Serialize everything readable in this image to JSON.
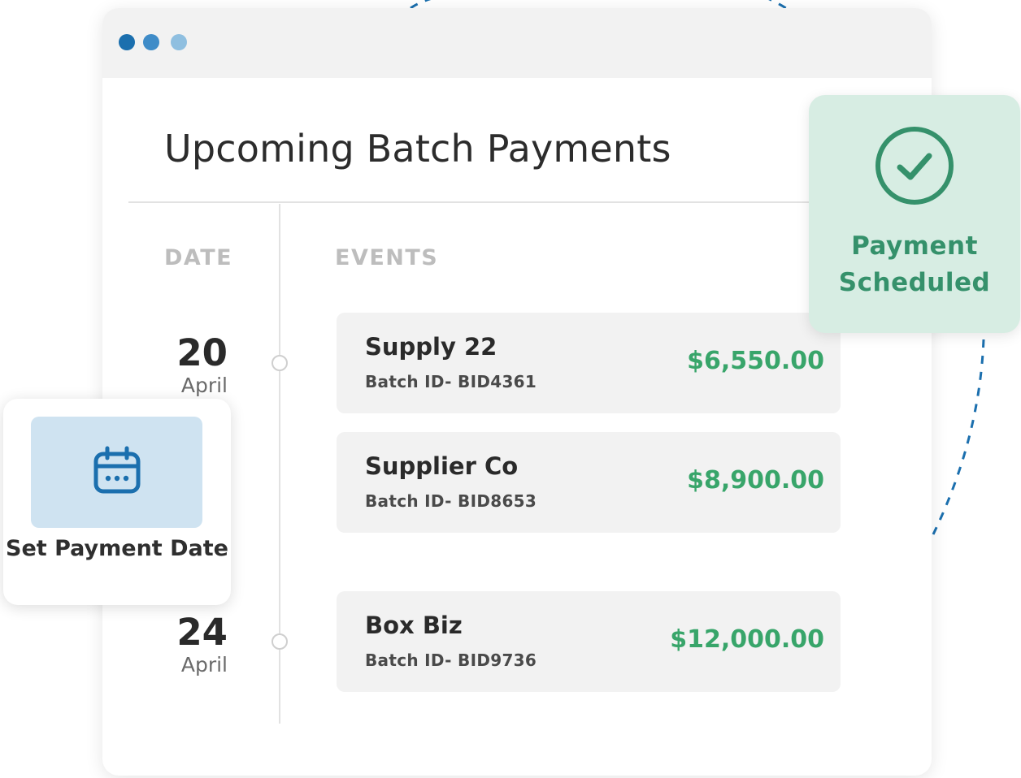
{
  "window": {
    "title": "Upcoming Batch Payments",
    "columns": {
      "date": "DATE",
      "events": "EVENTS"
    }
  },
  "dates": [
    {
      "day": "20",
      "month": "April"
    },
    {
      "day": "24",
      "month": "April"
    }
  ],
  "events": [
    {
      "name": "Supply 22",
      "batch": "Batch ID- BID4361",
      "amount": "$6,550.00"
    },
    {
      "name": "Supplier Co",
      "batch": "Batch ID- BID8653",
      "amount": "$8,900.00"
    },
    {
      "name": "Box Biz",
      "batch": "Batch ID- BID9736",
      "amount": "$12,000.00"
    }
  ],
  "status_card": {
    "label": "Payment Scheduled",
    "icon": "check-circle-icon"
  },
  "action_card": {
    "label": "Set Payment Date",
    "icon": "calendar-icon"
  },
  "colors": {
    "amount_green": "#38a56a",
    "status_bg": "#d7ede3",
    "status_text": "#35916b",
    "accent_blue": "#1b6fae",
    "tile_blue": "#cfe3f1"
  }
}
